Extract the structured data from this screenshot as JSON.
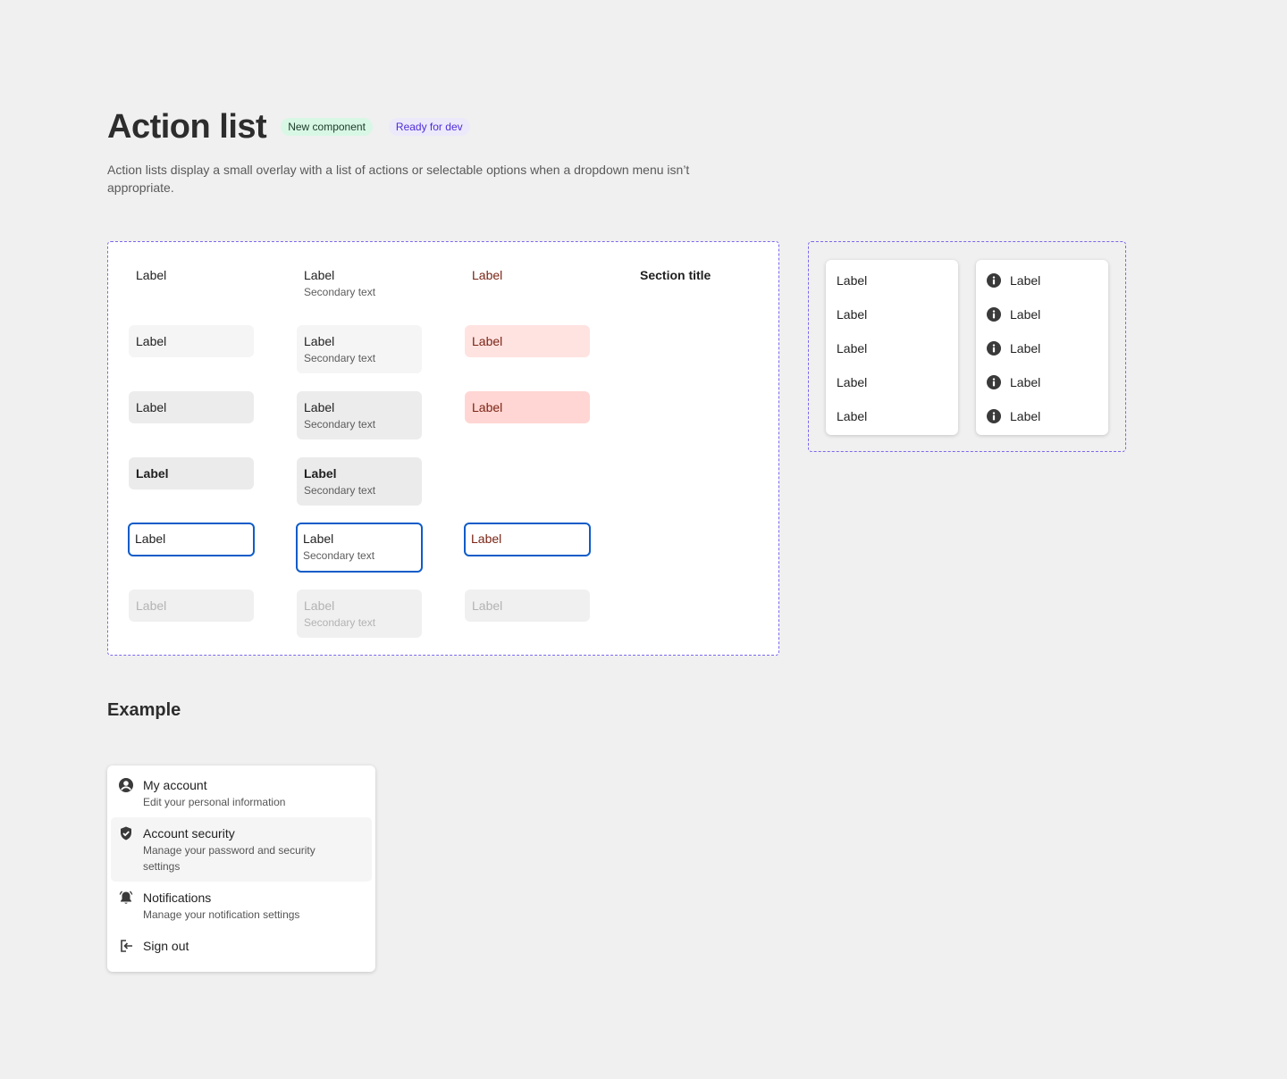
{
  "header": {
    "title": "Action list",
    "badges": [
      "New component",
      "Ready for dev"
    ],
    "description": "Action lists display a small overlay with a list of actions or selectable options when a dropdown menu isn’t appropriate."
  },
  "variants": {
    "label": "Label",
    "secondary": "Secondary text",
    "section_title": "Section title"
  },
  "popovers": {
    "plain_items": [
      "Label",
      "Label",
      "Label",
      "Label",
      "Label"
    ],
    "icon_items": [
      "Label",
      "Label",
      "Label",
      "Label",
      "Label"
    ],
    "icon": "info-icon"
  },
  "example": {
    "title": "Example",
    "items": [
      {
        "title": "My account",
        "subtitle": "Edit your personal information",
        "icon": "account-icon"
      },
      {
        "title": "Account security",
        "subtitle": "Manage your password and security settings",
        "icon": "shield-icon"
      },
      {
        "title": "Notifications",
        "subtitle": "Manage your notification settings",
        "icon": "bell-icon"
      },
      {
        "title": "Sign out",
        "subtitle": "",
        "icon": "sign-out-icon"
      }
    ]
  },
  "colors": {
    "focus": "#0f5cc8",
    "danger_text": "#7a2415",
    "danger_bg": "#ffe3e1",
    "dashed_border": "#7b68ee",
    "badge_new_bg": "#d9f7e5",
    "badge_ready_text": "#4f2dd8"
  }
}
